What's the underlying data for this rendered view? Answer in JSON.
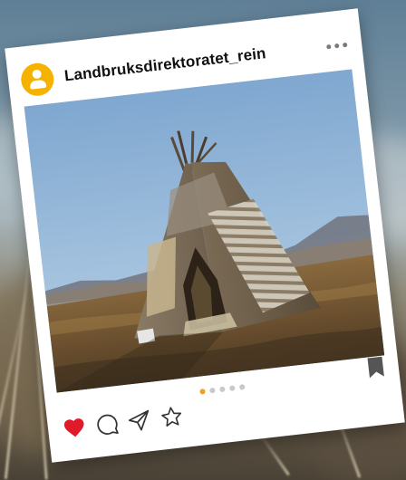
{
  "post": {
    "username": "Landbruksdirektoratet_rein",
    "image_subject": "lavvu-tent-in-tundra",
    "carousel": {
      "total": 5,
      "active_index": 0
    },
    "liked": true,
    "colors": {
      "avatar": "#f6b200",
      "like": "#e0192b",
      "pager_active": "#f0a020",
      "pager_inactive": "#c9c9c9"
    },
    "icons": [
      "menu-dots-icon",
      "heart-icon",
      "comment-icon",
      "share-icon",
      "star-icon",
      "bookmark-icon",
      "user-icon"
    ]
  }
}
